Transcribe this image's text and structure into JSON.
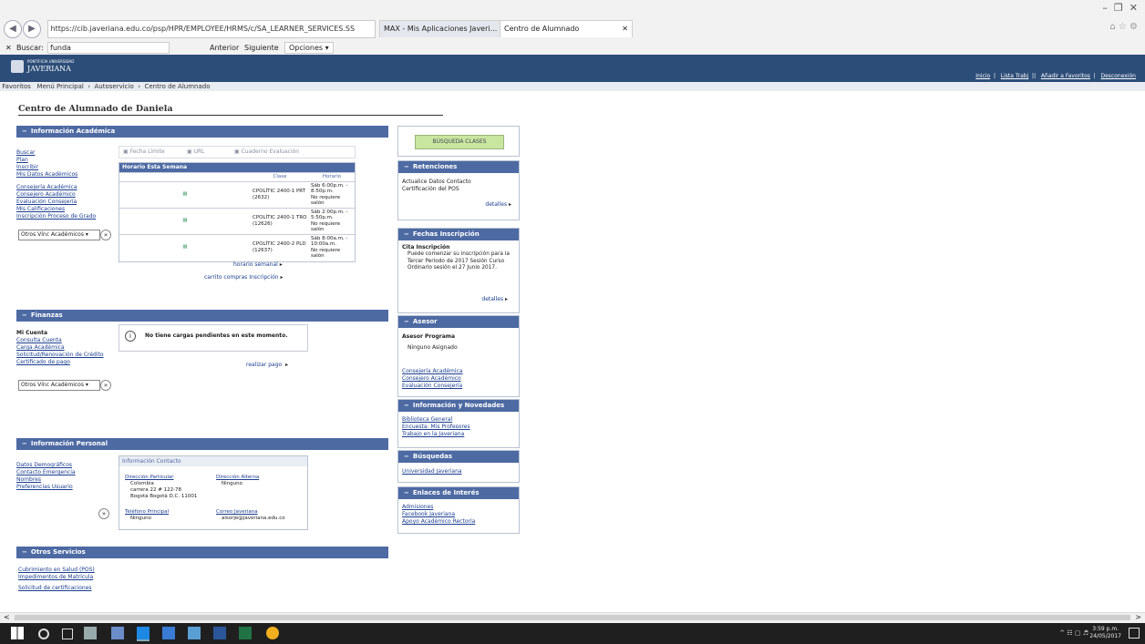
{
  "browser": {
    "url": "https://cib.javeriana.edu.co/psp/HPR/EMPLOYEE/HRMS/c/SA_LEARNER_SERVICES.SS",
    "tabs": [
      {
        "label": "MAX - Mis Aplicaciones Javeri..."
      },
      {
        "label": "Centro de Alumnado"
      }
    ],
    "find": {
      "label": "Buscar:",
      "value": "funda",
      "prev": "Anterior",
      "next": "Siguiente",
      "options": "Opciones"
    }
  },
  "site": {
    "logo_line1": "PONTIFICIA UNIVERSIDAD",
    "logo_line2": "JAVERIANA",
    "header_links": [
      "Inicio",
      "Lista Trabj",
      "Añadir a Favoritos",
      "Desconexión"
    ],
    "breadcrumb": [
      "Favoritos",
      "Menú Principal",
      "Autoservicio",
      "Centro de Alumnado"
    ]
  },
  "page": {
    "title": "Centro de Alumnado de Daniela"
  },
  "academic": {
    "header": "Información Académica",
    "links1": [
      "Buscar",
      "Plan",
      "Inscribir",
      "Mis Datos Académicos"
    ],
    "links2": [
      "Consejería Académica",
      "Consejero Académico",
      "Evaluación Consejería",
      "Mis Calificaciones",
      "Inscripción Proceso de Grado"
    ],
    "other_select": "Otros Vínc Académicos",
    "toolbar": [
      "Fecha Límite",
      "URL",
      "Cuaderno Evaluación"
    ],
    "schedule_title": "Horario Esta Semana",
    "col_clase": "Clase",
    "col_horario": "Horario",
    "classes": [
      {
        "clase": "CPOLÍTIC 2400-1 PRT (2632)",
        "horario": "Sáb 6:00p.m. - 8:50p.m.",
        "sala": "No requiere salón"
      },
      {
        "clase": "CPOLÍTIC 2400-1 TRO (12626)",
        "horario": "Sáb 2:00p.m. - 5:50p.m.",
        "sala": "No requiere salón"
      },
      {
        "clase": "CPOLÍTIC 2400-2 PLD (12637)",
        "horario": "Sáb 8:00a.m. - 10:00a.m.",
        "sala": "No requiere salón"
      }
    ],
    "weekly_link": "horario semanal",
    "cart_link": "carrito compras Inscripción"
  },
  "finance": {
    "header": "Finanzas",
    "account_title": "Mi Cuenta",
    "links": [
      "Consulta Cuenta",
      "Carga Académica",
      "Solicitud/Renovación de Crédito",
      "Certificado de pago"
    ],
    "other_select": "Otros Vínc Académicos",
    "message": "No tiene cargas pendientes en este momento.",
    "pay_link": "realizar pago"
  },
  "personal": {
    "header": "Información Personal",
    "links": [
      "Datos Demográficos",
      "Contacto Emergencia",
      "Nombres",
      "Preferencias Usuario"
    ],
    "contact_title": "Información Contacto",
    "home_addr_label": "Dirección Particular",
    "home_addr": [
      "Colombia",
      "carrera 22 # 122-78",
      "Bogotá Bogotá D.C. 11001"
    ],
    "alt_addr_label": "Dirección Alterna",
    "alt_addr": "Ninguno",
    "phone_label": "Teléfono Principal",
    "phone": "Ninguno",
    "email_label": "Correo Javeriana",
    "email": "alsorje@javeriana.edu.co"
  },
  "other_services": {
    "header": "Otros Servicios",
    "links": [
      "Cubrimiento en Salud (POS)",
      "Impedimentos de Matrícula",
      "Solicitud de certificaciones"
    ]
  },
  "right": {
    "search_button": "BÚSQUEDA CLASES",
    "retentions": {
      "header": "Retenciones",
      "items": [
        "Actualice Datos Contacto",
        "Certificación del POS"
      ],
      "details": "detalles"
    },
    "enroll": {
      "header": "Fechas Inscripción",
      "title": "Cita Inscripción",
      "text": "Puede comenzar su inscripción para la Tercer Periodo de 2017 Sesión Curso Ordinario sesión el 27 Junio 2017.",
      "details": "detalles"
    },
    "advisor": {
      "header": "Asesor",
      "title": "Asesor Programa",
      "value": "Ninguno Asignado",
      "links": [
        "Consejería Académica",
        "Consejero Académico",
        "Evaluación Consejería"
      ]
    },
    "news": {
      "header": "Información y Novedades",
      "links": [
        "Biblioteca General",
        "Encuesta: Mis Profesores",
        "Trabajo en la Javeriana"
      ]
    },
    "search": {
      "header": "Búsquedas",
      "links": [
        "Universidad Javeriana"
      ]
    },
    "interest": {
      "header": "Enlaces de Interés",
      "links": [
        "Admisiones",
        "Facebook Javeriana",
        "Apoyo Académico Rectoría"
      ]
    }
  },
  "taskbar": {
    "time": "3:59 p.m.",
    "date": "24/05/2017"
  },
  "colors": {
    "header_blue": "#2c4d78",
    "panel_blue": "#4d6aa3",
    "button_green": "#c9e6a0"
  }
}
